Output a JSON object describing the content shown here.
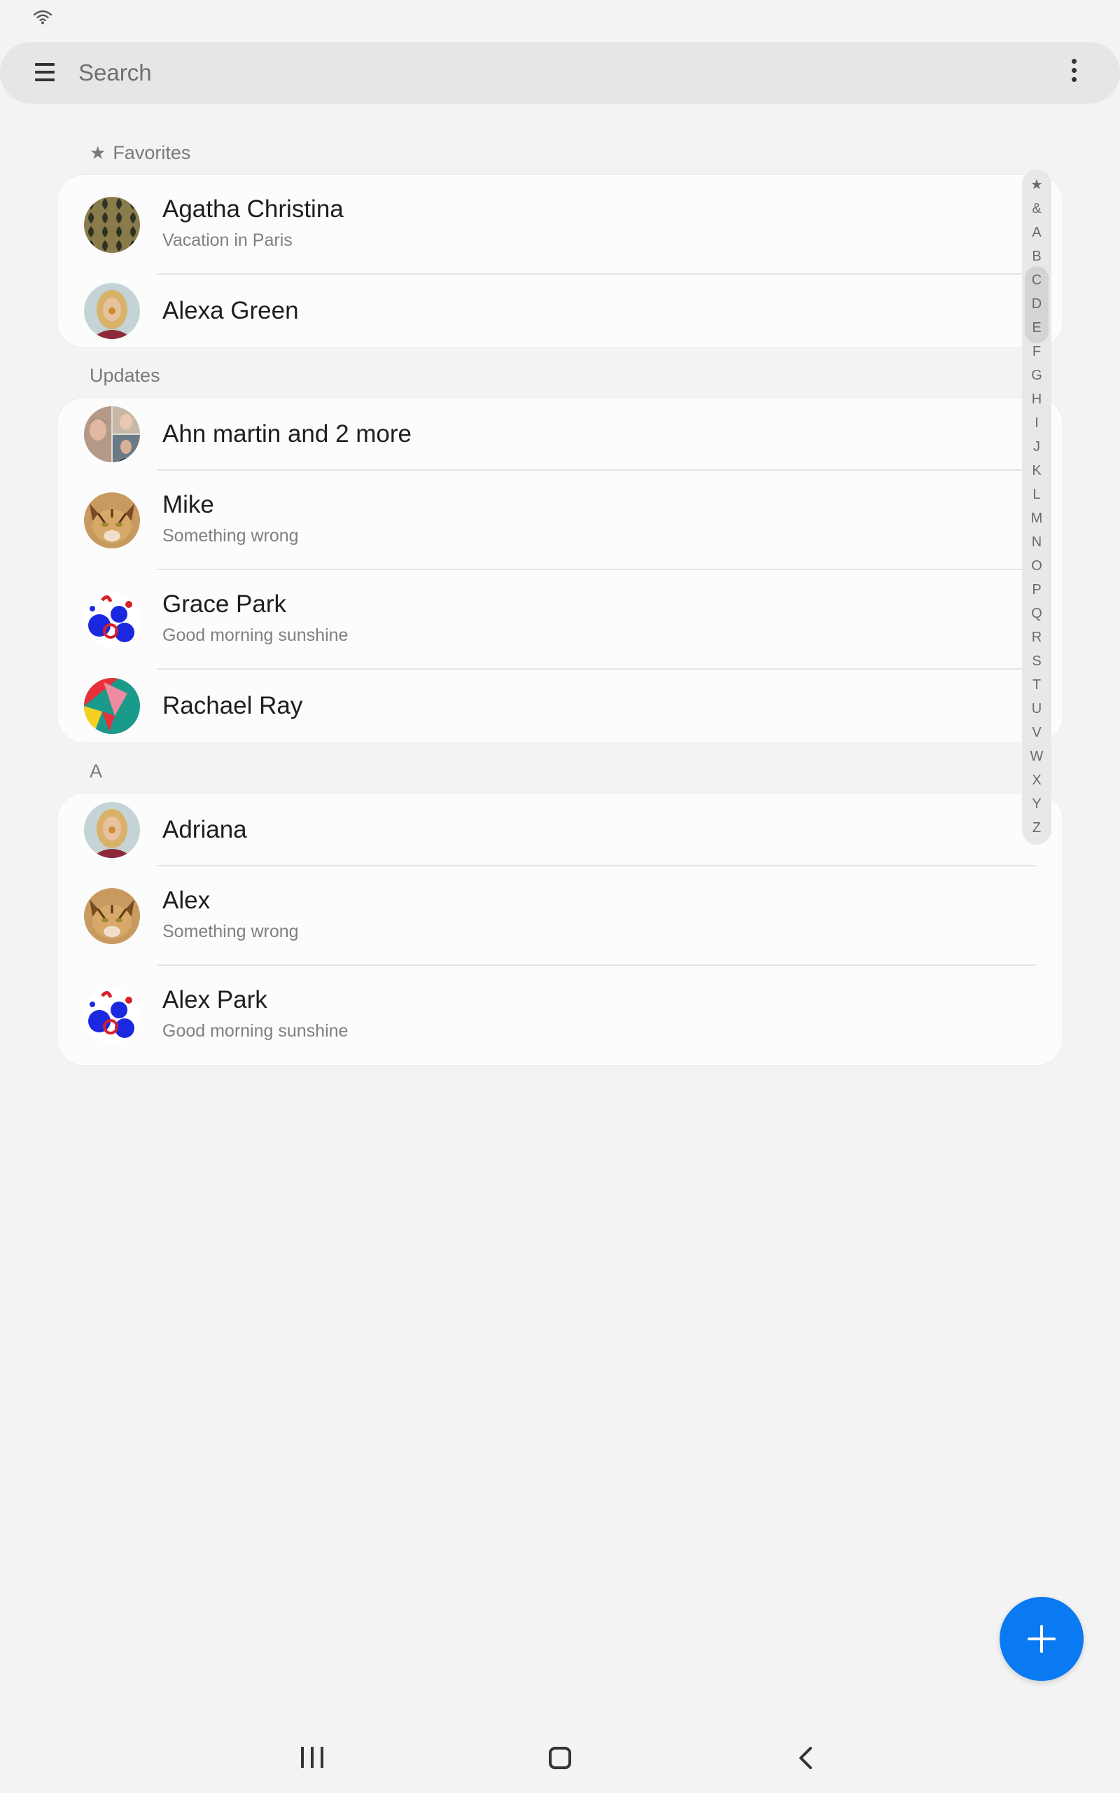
{
  "search": {
    "placeholder": "Search"
  },
  "sections": {
    "favorites": {
      "label": "Favorites",
      "items": [
        {
          "name": "Agatha Christina",
          "status": "Vacation in Paris",
          "avatar": "pattern-olive-avatar"
        },
        {
          "name": "Alexa Green",
          "avatar": "blonde-woman-photo-avatar"
        }
      ]
    },
    "updates": {
      "label": "Updates",
      "items": [
        {
          "name": "Ahn martin and 2 more",
          "avatar": "group-photo-avatar"
        },
        {
          "name": "Mike",
          "status": "Something wrong",
          "avatar": "cat-photo-avatar"
        },
        {
          "name": "Grace Park",
          "status": "Good morning sunshine",
          "avatar": "blue-red-pattern-avatar"
        },
        {
          "name": "Rachael Ray",
          "avatar": "geometric-color-avatar"
        }
      ]
    },
    "a": {
      "label": "A",
      "items": [
        {
          "name": "Adriana",
          "avatar": "blonde-woman-photo-avatar"
        },
        {
          "name": "Alex",
          "status": "Something wrong",
          "avatar": "cat-photo-avatar"
        },
        {
          "name": "Alex Park",
          "status": "Good morning sunshine",
          "avatar": "blue-red-pattern-avatar"
        }
      ]
    }
  },
  "index_letters": [
    "★",
    "&",
    "A",
    "B",
    "C",
    "D",
    "E",
    "F",
    "G",
    "H",
    "I",
    "J",
    "K",
    "L",
    "M",
    "N",
    "O",
    "P",
    "Q",
    "R",
    "S",
    "T",
    "U",
    "V",
    "W",
    "X",
    "Y",
    "Z"
  ],
  "colors": {
    "fab": "#0a7af3",
    "background": "#f3f3f3",
    "card": "#fcfcfc"
  },
  "icons": {
    "status": "wifi-icon",
    "menu": "hamburger-icon",
    "overflow": "more-vertical-icon",
    "fab": "plus-icon",
    "nav": [
      "recent-apps-icon",
      "home-icon",
      "back-icon"
    ]
  }
}
